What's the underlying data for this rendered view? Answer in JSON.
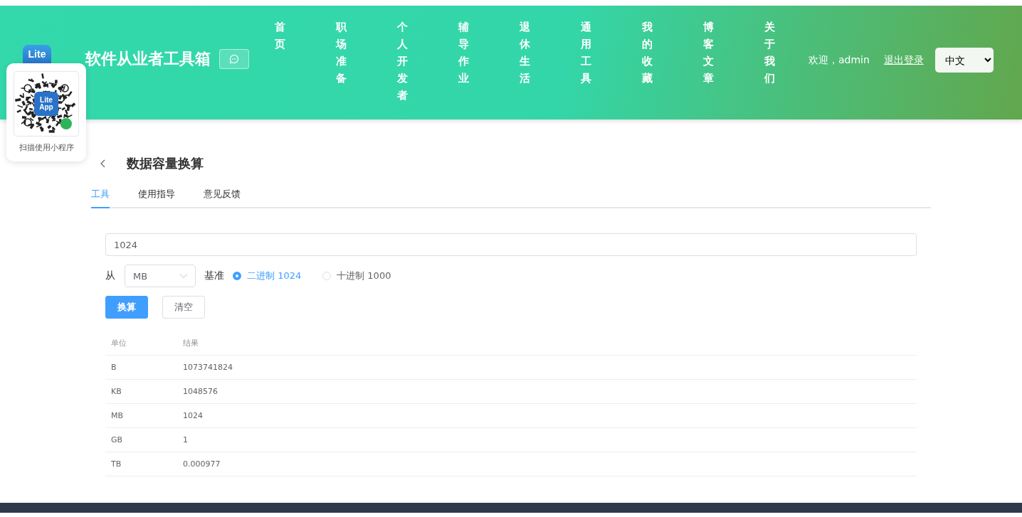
{
  "header": {
    "logo": {
      "line_1": "Lite"
    },
    "title": "软件从业者工具箱",
    "nav": [
      {
        "label": "首页"
      },
      {
        "label": "职场准备"
      },
      {
        "label": "个人开发者"
      },
      {
        "label": "辅导作业"
      },
      {
        "label": "退休生活"
      },
      {
        "label": "通用工具"
      },
      {
        "label": "我的收藏"
      },
      {
        "label": "博客文章"
      },
      {
        "label": "关于我们"
      }
    ],
    "welcome": "欢迎，admin",
    "logout": "退出登录",
    "language": "中文"
  },
  "qr_popup": {
    "logo": {
      "line_1": "Lite",
      "line_2": "App"
    },
    "caption": "扫描使用小程序"
  },
  "page": {
    "title": "数据容量换算",
    "tabs": [
      {
        "label": "工具",
        "selected": true
      },
      {
        "label": "使用指导",
        "selected": false
      },
      {
        "label": "意见反馈",
        "selected": false
      }
    ],
    "value": "1024",
    "from_label": "从",
    "unit": "MB",
    "base_label": "基准",
    "bases": [
      {
        "label": "二进制 1024",
        "selected": true
      },
      {
        "label": "十进制 1000",
        "selected": false
      }
    ],
    "buttons": [
      {
        "label": "换算",
        "kind": "primary"
      },
      {
        "label": "清空",
        "kind": "default"
      }
    ],
    "table": {
      "columns": [
        "单位",
        "结果"
      ],
      "rows": [
        [
          "B",
          "1073741824"
        ],
        [
          "KB",
          "1048576"
        ],
        [
          "MB",
          "1024"
        ],
        [
          "GB",
          "1"
        ],
        [
          "TB",
          "0.000977"
        ]
      ]
    }
  }
}
